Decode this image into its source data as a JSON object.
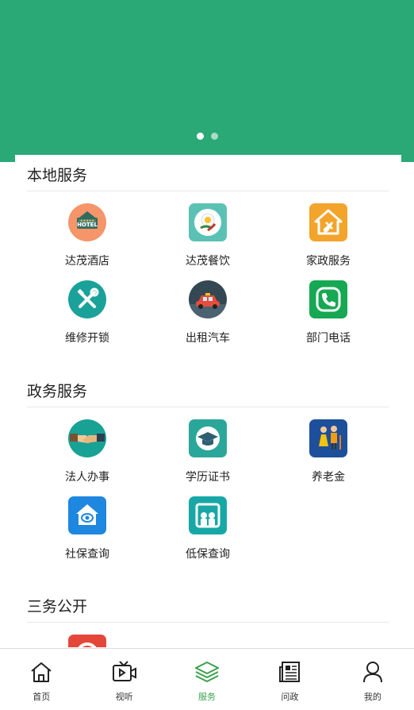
{
  "banner": {
    "slides": 2,
    "active_slide": 0
  },
  "sections": [
    {
      "title": "本地服务",
      "items": [
        {
          "label": "达茂酒店",
          "icon": "hotel-icon",
          "color": "#f59569"
        },
        {
          "label": "达茂餐饮",
          "icon": "food-icon",
          "color": "#5cc1b5"
        },
        {
          "label": "家政服务",
          "icon": "housekeeping-icon",
          "color": "#f3a42a"
        },
        {
          "label": "维修开锁",
          "icon": "repair-tools-icon",
          "color": "#1aa19a"
        },
        {
          "label": "出租汽车",
          "icon": "taxi-icon",
          "color": "#344853"
        },
        {
          "label": "部门电话",
          "icon": "phone-icon",
          "color": "#16a852"
        }
      ]
    },
    {
      "title": "政务服务",
      "items": [
        {
          "label": "法人办事",
          "icon": "handshake-icon",
          "color": "#17a295"
        },
        {
          "label": "学历证书",
          "icon": "graduation-cap-icon",
          "color": "#2aa79a"
        },
        {
          "label": "养老金",
          "icon": "elderly-couple-icon",
          "color": "#1d4f9a"
        },
        {
          "label": "社保查询",
          "icon": "social-security-house-icon",
          "color": "#1e87e0"
        },
        {
          "label": "低保查询",
          "icon": "welfare-icon",
          "color": "#17a8a6"
        }
      ]
    },
    {
      "title": "三务公开",
      "items": [
        {
          "label": "",
          "icon": "disclosure-icon",
          "color": "#e5463a"
        }
      ]
    }
  ],
  "nav": [
    {
      "label": "首页",
      "icon": "home-icon",
      "active": false
    },
    {
      "label": "视听",
      "icon": "tv-icon",
      "active": false
    },
    {
      "label": "服务",
      "icon": "layers-icon",
      "active": true
    },
    {
      "label": "问政",
      "icon": "newspaper-icon",
      "active": false
    },
    {
      "label": "我的",
      "icon": "user-icon",
      "active": false
    }
  ],
  "colors": {
    "brand": "#2aa876",
    "nav_active": "#3aa24d"
  }
}
